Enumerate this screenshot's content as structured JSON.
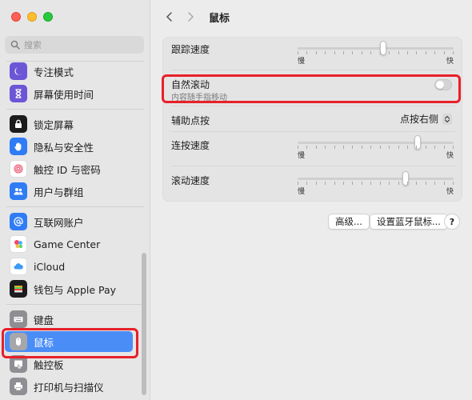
{
  "window": {
    "title": "鼠标"
  },
  "search": {
    "placeholder": "搜索"
  },
  "sidebar": {
    "items": [
      {
        "label": "专注模式",
        "icon": "moon-icon",
        "color": "#6d56d6"
      },
      {
        "label": "屏幕使用时间",
        "icon": "hourglass-icon",
        "color": "#6d56d6"
      },
      {
        "label": "锁定屏幕",
        "icon": "lock-icon",
        "color": "#1c1c1e"
      },
      {
        "label": "隐私与安全性",
        "icon": "hand-icon",
        "color": "#2f7cf6"
      },
      {
        "label": "触控 ID 与密码",
        "icon": "fingerprint-icon",
        "color": "#ffffff"
      },
      {
        "label": "用户与群组",
        "icon": "users-icon",
        "color": "#2f7cf6"
      },
      {
        "label": "互联网账户",
        "icon": "at-icon",
        "color": "#2f7cf6"
      },
      {
        "label": "Game Center",
        "icon": "game-center-icon",
        "color": "#ffffff"
      },
      {
        "label": "iCloud",
        "icon": "cloud-icon",
        "color": "#ffffff"
      },
      {
        "label": "钱包与 Apple Pay",
        "icon": "wallet-icon",
        "color": "#1c1c1e"
      },
      {
        "label": "键盘",
        "icon": "keyboard-icon",
        "color": "#8e8e93"
      },
      {
        "label": "鼠标",
        "icon": "mouse-icon",
        "color": "#8e8e93",
        "selected": true
      },
      {
        "label": "触控板",
        "icon": "trackpad-icon",
        "color": "#8e8e93"
      },
      {
        "label": "打印机与扫描仪",
        "icon": "printer-icon",
        "color": "#8e8e93"
      }
    ]
  },
  "settings": {
    "tracking_speed": {
      "label": "跟踪速度",
      "min": "慢",
      "max": "快",
      "value": 0.55
    },
    "natural_scroll": {
      "label": "自然滚动",
      "sub": "内容随手指移动",
      "enabled": false
    },
    "secondary_click": {
      "label": "辅助点按",
      "value": "点按右侧"
    },
    "double_click": {
      "label": "连按速度",
      "min": "慢",
      "max": "快",
      "value": 0.78
    },
    "scroll_speed": {
      "label": "滚动速度",
      "min": "慢",
      "max": "快",
      "value": 0.7
    }
  },
  "buttons": {
    "advanced": "高级...",
    "bluetooth": "设置蓝牙鼠标...",
    "help": "?"
  },
  "colors": {
    "accent": "#4a8df7",
    "highlight": "#e8202a"
  }
}
